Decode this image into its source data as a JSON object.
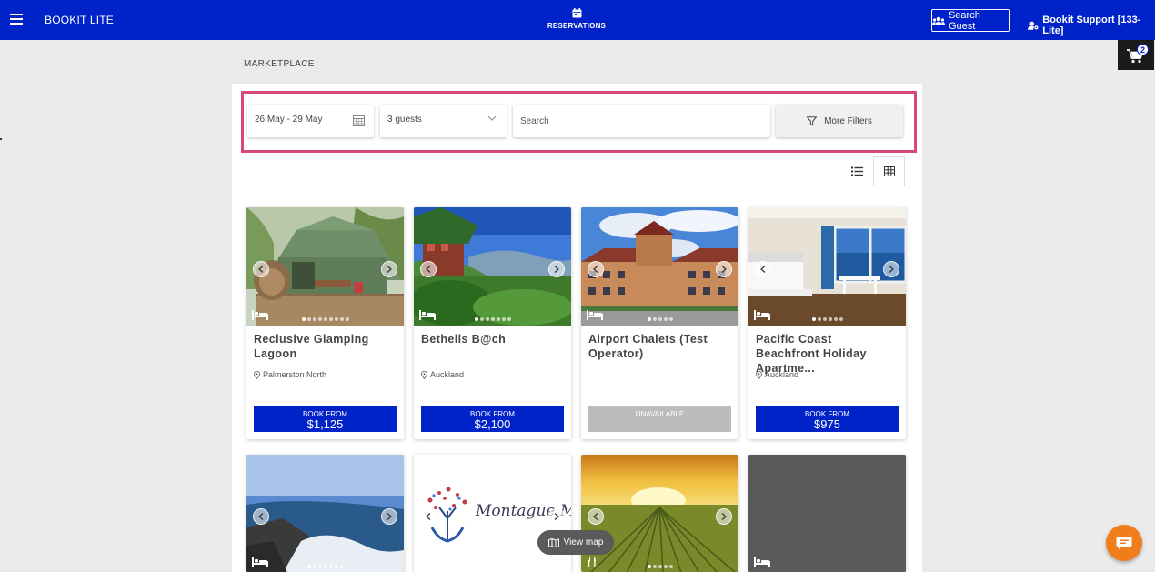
{
  "header": {
    "brand": "BOOKIT LITE",
    "nav_reservations": "RESERVATIONS",
    "search_guest": "Search Guest",
    "user": "Bookit Support [133-Lite]",
    "cart_count": "2",
    "icons": {
      "menu": "hamburger-icon",
      "reservations": "calendar-icon",
      "search_guest": "users-icon",
      "user": "user-gear-icon",
      "cart": "cart-icon"
    }
  },
  "breadcrumb": "MARKETPLACE",
  "filters": {
    "dates": "26 May - 29 May",
    "guests": "3 guests",
    "search_placeholder": "Search",
    "more_filters": "More Filters"
  },
  "colors": {
    "brand": "#0022c9",
    "highlight": "#d6477e",
    "unavailable": "#bcbcbc",
    "chat": "#f07d1a"
  },
  "cards": [
    {
      "title": "Reclusive Glamping Lagoon",
      "location": "Palmerston North",
      "book_label": "BOOK FROM",
      "price": "$1,125",
      "available": true
    },
    {
      "title": "Bethells B@ch",
      "location": "Auckland",
      "book_label": "BOOK FROM",
      "price": "$2,100",
      "available": true
    },
    {
      "title": "Airport Chalets (Test Operator)",
      "location": "",
      "book_label": "UNAVAILABLE",
      "price": "",
      "available": false
    },
    {
      "title": "Pacific Coast Beachfront Holiday Apartme...",
      "location": "Auckland",
      "book_label": "BOOK FROM",
      "price": "$975",
      "available": true
    }
  ],
  "row2_logo_text": "Montague M",
  "view_map": "View map"
}
